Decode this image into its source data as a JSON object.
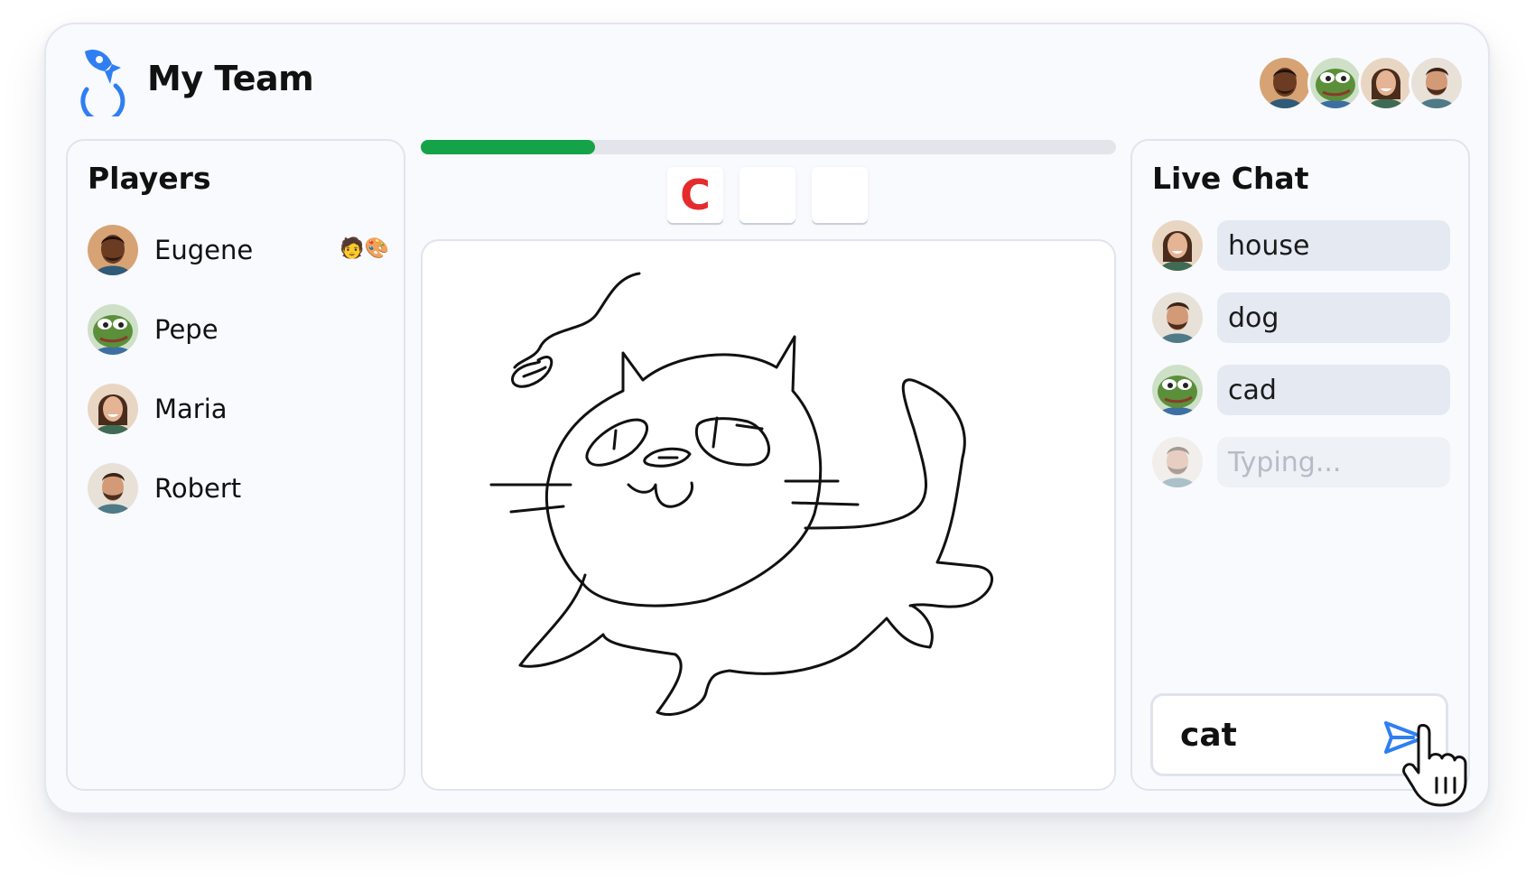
{
  "header": {
    "title": "My Team",
    "team_avatars": [
      "eugene",
      "pepe",
      "maria",
      "robert"
    ]
  },
  "game": {
    "progress_percent": 25,
    "letters": [
      "C",
      "",
      ""
    ]
  },
  "players": {
    "title": "Players",
    "items": [
      {
        "name": "Eugene",
        "status": "🧑🎨"
      },
      {
        "name": "Pepe",
        "status": ""
      },
      {
        "name": "Maria",
        "status": ""
      },
      {
        "name": "Robert",
        "status": ""
      }
    ]
  },
  "chat": {
    "title": "Live Chat",
    "messages": [
      {
        "user": "maria",
        "text": "house"
      },
      {
        "user": "robert",
        "text": "dog"
      },
      {
        "user": "pepe",
        "text": "cad"
      }
    ],
    "typing": {
      "user": "robert",
      "text": "Typing..."
    },
    "input_value": "cat"
  },
  "colors": {
    "accent": "#2f7ff2",
    "progress": "#15a34a",
    "letter": "#e52b2b"
  }
}
